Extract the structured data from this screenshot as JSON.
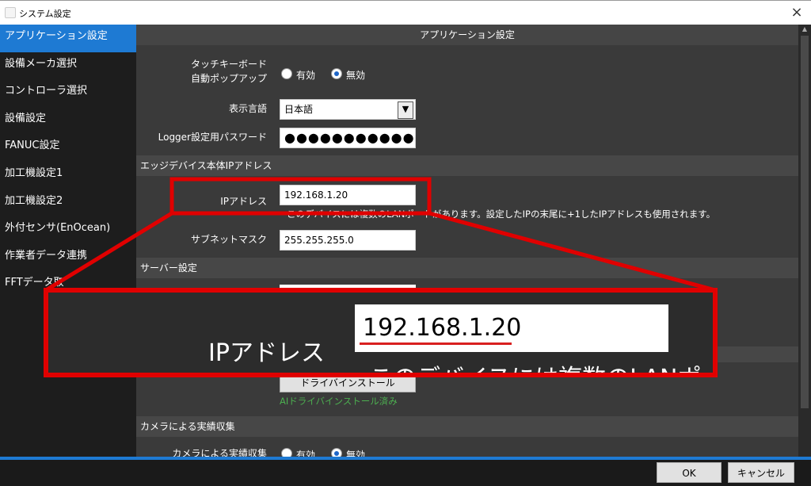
{
  "window": {
    "title": "システム設定",
    "close": "×"
  },
  "sidebar": {
    "items": [
      {
        "label": "アプリケーション設定",
        "active": true
      },
      {
        "label": "設備メーカ選択"
      },
      {
        "label": "コントローラ選択"
      },
      {
        "label": "設備設定"
      },
      {
        "label": "FANUC設定"
      },
      {
        "label": "加工機設定1"
      },
      {
        "label": "加工機設定2"
      },
      {
        "label": "外付センサ(EnOcean)"
      },
      {
        "label": "作業者データ連携"
      },
      {
        "label": "FFTデータ取"
      }
    ]
  },
  "main": {
    "header": "アプリケーション設定",
    "touch_keyboard": {
      "label_line1": "タッチキーボード",
      "label_line2": "自動ポップアップ",
      "opt_enabled": "有効",
      "opt_disabled": "無効",
      "selected": "無効"
    },
    "language": {
      "label": "表示言語",
      "value": "日本語"
    },
    "logger_password": {
      "label": "Logger設定用パスワード",
      "value": "●●●●●●●●●●●"
    },
    "section_ip": "エッジデバイス本体IPアドレス",
    "ip": {
      "label": "IPアドレス",
      "value": "192.168.1.20",
      "note": "このデバイスには複数のLANポートがあります。設定したIPの末尾に+1したIPアドレスも使用されます。"
    },
    "subnet": {
      "label": "サブネットマスク",
      "value": "255.255.255.0"
    },
    "section_server": "サーバー設定",
    "driver_install_button": "ドライバインストール",
    "ai_driver_status": "AIドライバインストール済み",
    "section_camera": "カメラによる実績収集",
    "camera_row": {
      "label": "カメラによる実績収集",
      "opt_enabled": "有効",
      "opt_disabled": "無効"
    }
  },
  "zoom_callout": {
    "label": "IPアドレス",
    "value": "192.168.1.20",
    "note": "このデバイスには複数のLANポート"
  },
  "footer": {
    "ok": "OK",
    "cancel": "キャンセル"
  },
  "colors": {
    "accent": "#1e7ad3",
    "highlight_red": "#e00000",
    "status_green": "#4caf50"
  }
}
